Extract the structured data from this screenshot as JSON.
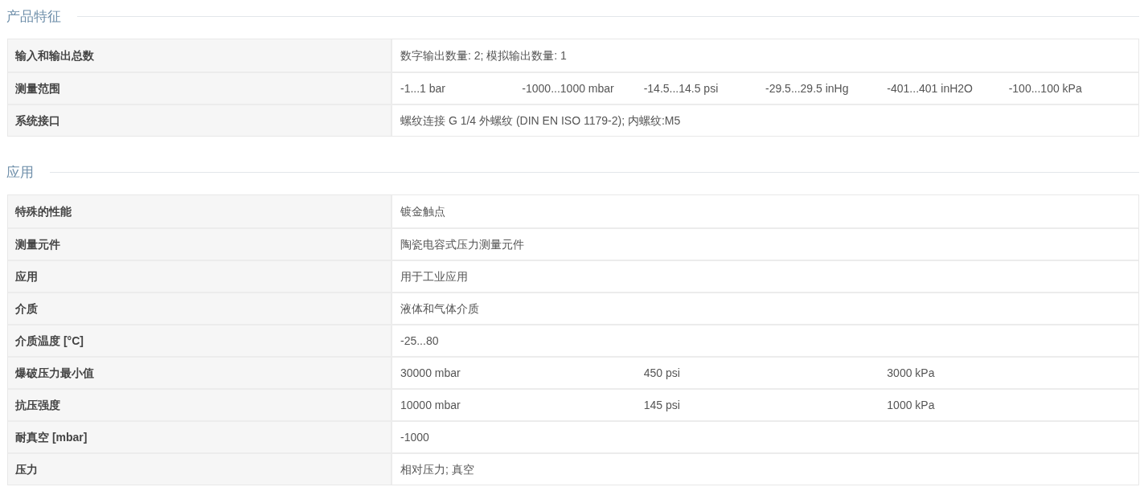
{
  "sections": [
    {
      "title": "产品特征",
      "rows": [
        {
          "label": "输入和输出总数",
          "values": [
            "数字输出数量: 2; 模拟输出数量: 1"
          ]
        },
        {
          "label": "测量范围",
          "values": [
            "-1...1 bar",
            "-1000...1000 mbar",
            "-14.5...14.5 psi",
            "-29.5...29.5 inHg",
            "-401...401 inH2O",
            "-100...100 kPa"
          ]
        },
        {
          "label": "系统接口",
          "values": [
            "螺纹连接 G 1/4 外螺纹 (DIN EN ISO 1179-2); 内螺纹:M5"
          ]
        }
      ]
    },
    {
      "title": "应用",
      "rows": [
        {
          "label": "特殊的性能",
          "values": [
            "镀金触点"
          ]
        },
        {
          "label": "测量元件",
          "values": [
            "陶瓷电容式压力测量元件"
          ]
        },
        {
          "label": "应用",
          "values": [
            "用于工业应用"
          ]
        },
        {
          "label": "介质",
          "values": [
            "液体和气体介质"
          ]
        },
        {
          "label": "介质温度 [°C]",
          "values": [
            "-25...80"
          ]
        },
        {
          "label": "爆破压力最小值",
          "values": [
            "30000 mbar",
            "450 psi",
            "3000 kPa"
          ]
        },
        {
          "label": "抗压强度",
          "values": [
            "10000 mbar",
            "145 psi",
            "1000 kPa"
          ]
        },
        {
          "label": "耐真空 [mbar]",
          "values": [
            "-1000"
          ]
        },
        {
          "label": "压力",
          "values": [
            "相对压力; 真空"
          ]
        }
      ]
    }
  ]
}
